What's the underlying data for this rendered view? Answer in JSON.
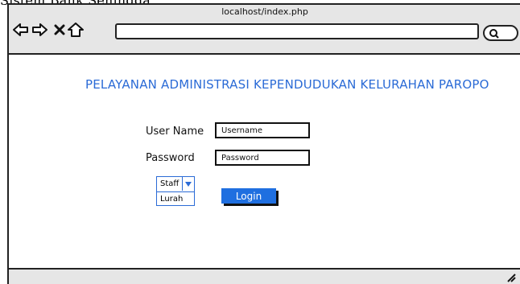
{
  "top_fragment": "Sistem Bank Sehingga",
  "browser": {
    "url": "localhost/index.php",
    "icons": [
      "back-arrow-icon",
      "forward-arrow-icon",
      "close-x-icon",
      "home-icon",
      "search-icon",
      "resize-grip-icon"
    ]
  },
  "page": {
    "title": "PELAYANAN ADMINISTRASI KEPENDUDUKAN KELURAHAN PAROPO"
  },
  "form": {
    "username_label": "User Name",
    "username_placeholder": "Username",
    "password_label": "Password",
    "password_placeholder": "Password",
    "role_selected": "Staff",
    "role_option": "Lurah",
    "login_label": "Login"
  },
  "colors": {
    "title": "#2b6bd6",
    "login_button": "#1f6fe0",
    "chrome": "#e6e6e6"
  }
}
